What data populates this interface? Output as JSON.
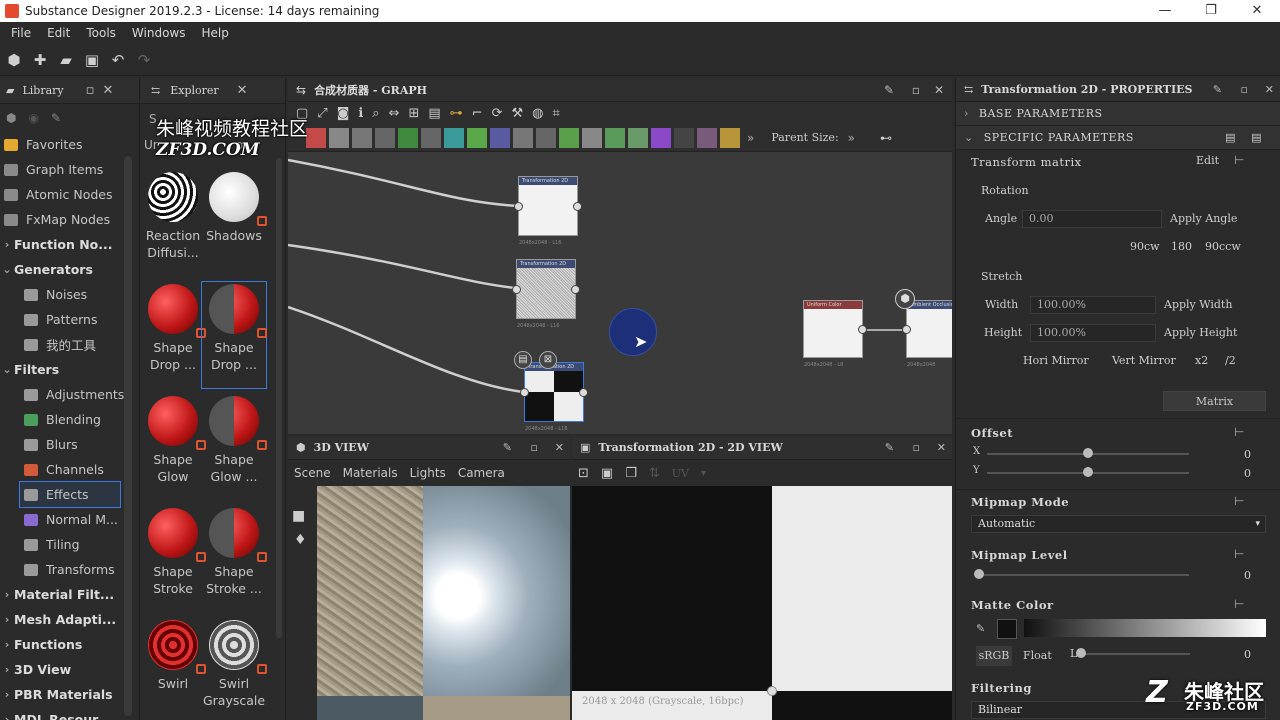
{
  "window": {
    "title": "Substance Designer 2019.2.3 - License: 14 days remaining",
    "controls": [
      "—",
      "❐",
      "✕"
    ]
  },
  "menu": [
    "File",
    "Edit",
    "Tools",
    "Windows",
    "Help"
  ],
  "library": {
    "tab_label": "Library",
    "items": [
      {
        "label": "Favorites",
        "bold": false,
        "arrow": "",
        "color": "#e5a92f"
      },
      {
        "label": "Graph Items",
        "bold": false,
        "arrow": "",
        "color": "#8a8a8a"
      },
      {
        "label": "Atomic Nodes",
        "bold": false,
        "arrow": "",
        "color": "#8a8a8a"
      },
      {
        "label": "FxMap Nodes",
        "bold": false,
        "arrow": "",
        "color": "#8a8a8a"
      },
      {
        "label": "Function No...",
        "bold": true,
        "arrow": "›",
        "color": ""
      },
      {
        "label": "Generators",
        "bold": true,
        "arrow": "⌄",
        "color": ""
      },
      {
        "label": "Noises",
        "bold": false,
        "arrow": "",
        "color": "#9a9a9a",
        "indent": true
      },
      {
        "label": "Patterns",
        "bold": false,
        "arrow": "",
        "color": "#9a9a9a",
        "indent": true
      },
      {
        "label": "我的工具",
        "bold": false,
        "arrow": "",
        "color": "#9a9a9a",
        "indent": true
      },
      {
        "label": "Filters",
        "bold": true,
        "arrow": "⌄",
        "color": ""
      },
      {
        "label": "Adjustments",
        "bold": false,
        "arrow": "",
        "color": "#9a9a9a",
        "indent": true
      },
      {
        "label": "Blending",
        "bold": false,
        "arrow": "",
        "color": "#4aa05a",
        "indent": true
      },
      {
        "label": "Blurs",
        "bold": false,
        "arrow": "",
        "color": "#9a9a9a",
        "indent": true
      },
      {
        "label": "Channels",
        "bold": false,
        "arrow": "",
        "color": "#d05a3a",
        "indent": true
      },
      {
        "label": "Effects",
        "bold": false,
        "arrow": "",
        "color": "#9a9a9a",
        "indent": true,
        "selected": true
      },
      {
        "label": "Normal M...",
        "bold": false,
        "arrow": "",
        "color": "#8a6ad0",
        "indent": true
      },
      {
        "label": "Tiling",
        "bold": false,
        "arrow": "",
        "color": "#9a9a9a",
        "indent": true
      },
      {
        "label": "Transforms",
        "bold": false,
        "arrow": "",
        "color": "#9a9a9a",
        "indent": true
      },
      {
        "label": "Material Filt...",
        "bold": true,
        "arrow": "›",
        "color": ""
      },
      {
        "label": "Mesh Adapti...",
        "bold": true,
        "arrow": "›",
        "color": ""
      },
      {
        "label": "Functions",
        "bold": true,
        "arrow": "›",
        "color": ""
      },
      {
        "label": "3D View",
        "bold": true,
        "arrow": "›",
        "color": ""
      },
      {
        "label": "PBR Materials",
        "bold": true,
        "arrow": "›",
        "color": ""
      },
      {
        "label": "MDL Resour...",
        "bold": true,
        "arrow": "›",
        "color": ""
      }
    ]
  },
  "explorer": {
    "tab_label": "Explorer",
    "search_value": "S",
    "header_partial": "Ur",
    "header_partial2": "or...",
    "thumbs": [
      {
        "label": "Reaction\nDiffusi...",
        "style": "reaction"
      },
      {
        "label": "Shadows",
        "style": "white"
      },
      {
        "label": "Shape\nDrop ...",
        "style": "red"
      },
      {
        "label": "Shape\nDrop ...",
        "style": "redhalf",
        "selected": true
      },
      {
        "label": "Shape\nGlow",
        "style": "red"
      },
      {
        "label": "Shape\nGlow ...",
        "style": "redhalf"
      },
      {
        "label": "Shape\nStroke",
        "style": "red"
      },
      {
        "label": "Shape\nStroke ...",
        "style": "redhalf"
      },
      {
        "label": "Swirl",
        "style": "swirlred"
      },
      {
        "label": "Swirl\nGrayscale",
        "style": "swirlgray"
      }
    ]
  },
  "graph": {
    "tab_title": "合成材质器 - GRAPH",
    "parent_size_label": "Parent Size:",
    "nodes": [
      {
        "title": "Transformation 2D",
        "size": "2048x2048 - L16"
      },
      {
        "title": "Transformation 2D",
        "size": "2048x2048 - L16"
      },
      {
        "title": "Transformation 2D",
        "size": "2048x2048 - L16"
      },
      {
        "title": "Uniform Color",
        "size": "2048x2048 - L8"
      },
      {
        "title": "Ambient Occlusion",
        "size": "2048x2048"
      }
    ]
  },
  "view3d": {
    "tab_title": "3D VIEW",
    "menu": [
      "Scene",
      "Materials",
      "Lights",
      "Camera"
    ]
  },
  "view2d": {
    "tab_title": "Transformation 2D - 2D VIEW",
    "uv_label": "UV",
    "info": "2048 x 2048 (Grayscale, 16bpc)"
  },
  "properties": {
    "tab_title": "Transformation 2D - PROPERTIES",
    "base_params": "BASE PARAMETERS",
    "specific_params": "SPECIFIC PARAMETERS",
    "transform_matrix": "Transform matrix",
    "edit": "Edit",
    "rotation": "Rotation",
    "angle_label": "Angle",
    "angle_value": "0.00",
    "apply_angle": "Apply Angle",
    "rot_buttons": [
      "90cw",
      "180",
      "90ccw"
    ],
    "stretch": "Stretch",
    "width_label": "Width",
    "width_value": "100.00%",
    "apply_width": "Apply Width",
    "height_label": "Height",
    "height_value": "100.00%",
    "apply_height": "Apply Height",
    "mirror_buttons": [
      "Hori Mirror",
      "Vert Mirror",
      "x2",
      "/2"
    ],
    "matrix_button": "Matrix",
    "offset": "Offset",
    "offset_x_label": "X",
    "offset_y_label": "Y",
    "offset_x": "0",
    "offset_y": "0",
    "offset_x_pos": 0.5,
    "offset_y_pos": 0.5,
    "mipmap_mode": "Mipmap Mode",
    "mipmap_mode_value": "Automatic",
    "mipmap_level": "Mipmap Level",
    "mipmap_level_value": "0",
    "matte_color": "Matte Color",
    "srgb": "sRGB",
    "float": "Float",
    "l_label": "L",
    "matte_value": "0",
    "filtering": "Filtering",
    "filtering_value": "Bilinear"
  },
  "watermark": {
    "cn_top": "朱峰视频教程社区",
    "en_top": "ZF3D.COM",
    "cn_bottom": "朱峰社区",
    "en_bottom": "ZF3D.COM"
  }
}
